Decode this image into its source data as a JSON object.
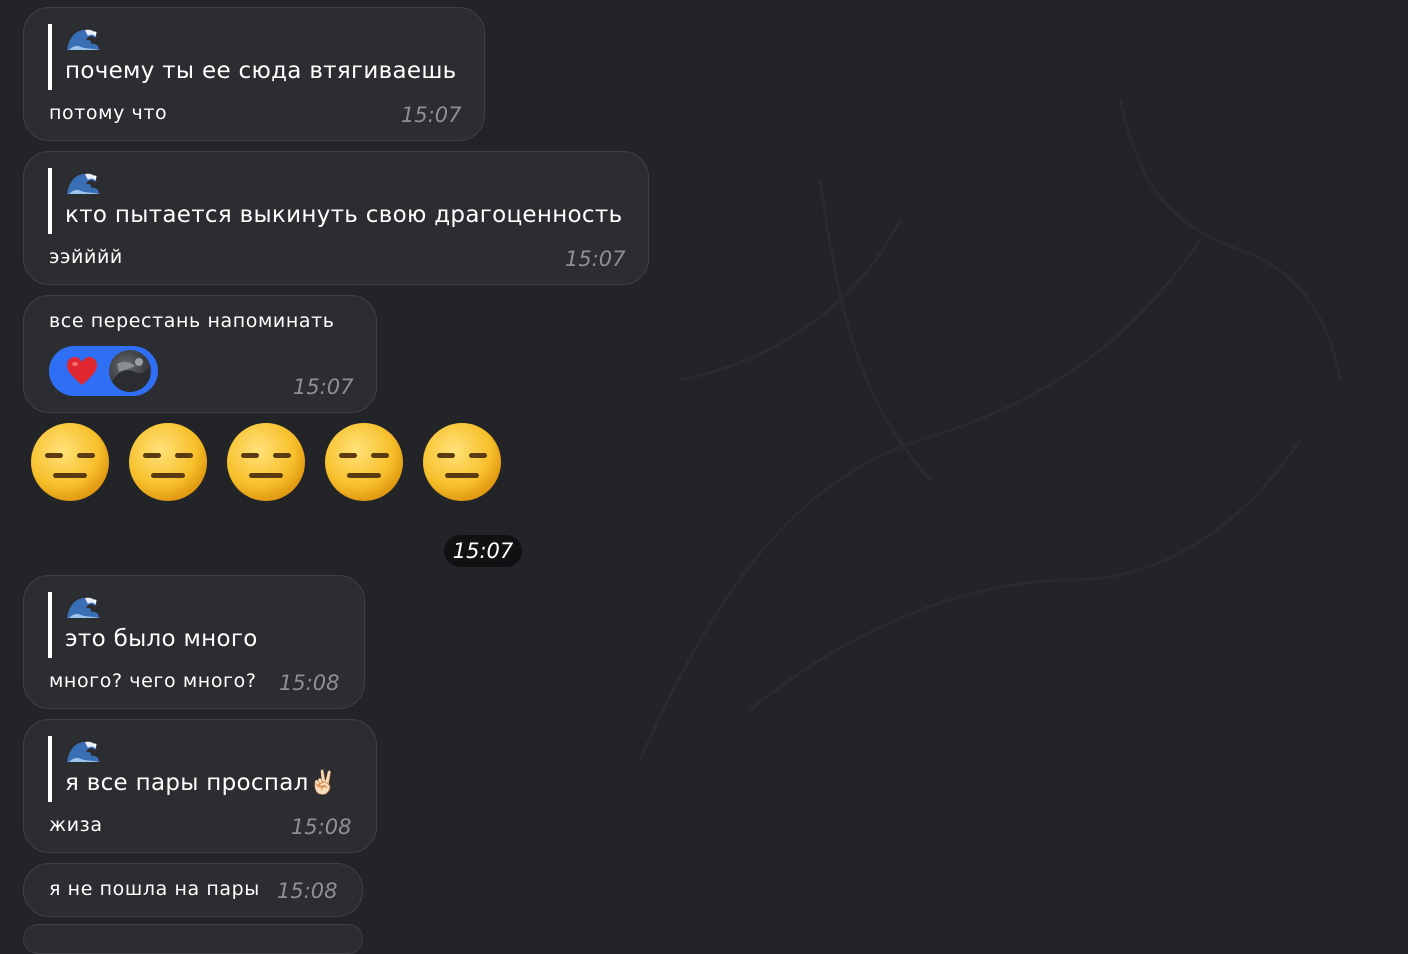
{
  "messages": [
    {
      "quote_text": "почему ты ее сюда втягиваешь",
      "text": "потому что",
      "time": "15:07"
    },
    {
      "quote_text": "кто пытается выкинуть свою драгоценность",
      "text": "ээйййй",
      "time": "15:07"
    },
    {
      "text": "все перестань напоминать",
      "time": "15:07",
      "reaction": "heart"
    },
    {
      "quote_text": "это было много",
      "text": "много? чего много?",
      "time": "15:08"
    },
    {
      "quote_text": "я все пары проспал",
      "quote_emoji": "✌🏻",
      "text": "жиза",
      "time": "15:08"
    },
    {
      "text": "я не пошла на пары",
      "time": "15:08"
    }
  ],
  "emoji_row": {
    "emoji": "😑",
    "count": 5,
    "time": "15:07"
  },
  "quote_icon": "great-wave-icon",
  "colors": {
    "background": "#232427",
    "bubble": "#2c2d30",
    "time_text": "#8e8f93",
    "reaction_pill": "#2f6ff6",
    "date_pill": "#101113"
  }
}
